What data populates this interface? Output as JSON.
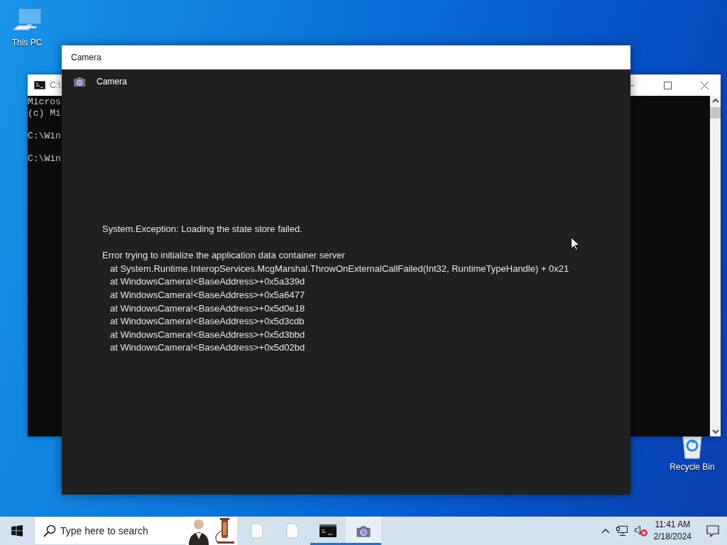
{
  "desktop_icons": [
    {
      "kind": "computer",
      "label": "This PC"
    },
    {
      "kind": "recycle",
      "label": "Recycle Bin"
    }
  ],
  "console_window": {
    "title": "C:\\",
    "blocks": [
      [
        "Micros",
        "(c) Mi"
      ],
      [
        "C:\\Win"
      ],
      [
        "C:\\Win"
      ]
    ]
  },
  "camera_window": {
    "title": "Camera",
    "app_title": "Camera",
    "error_heading": "System.Exception: Loading the state store failed.",
    "error_message": "Error trying to initialize the application data container server",
    "stack": [
      "at System.Runtime.InteropServices.McgMarshal.ThrowOnExternalCallFailed(Int32, RuntimeTypeHandle) + 0x21",
      "at WindowsCamera!<BaseAddress>+0x5a339d",
      "at WindowsCamera!<BaseAddress>+0x5a6477",
      "at WindowsCamera!<BaseAddress>+0x5d0e18",
      "at WindowsCamera!<BaseAddress>+0x5d3cdb",
      "at WindowsCamera!<BaseAddress>+0x5d3bbd",
      "at WindowsCamera!<BaseAddress>+0x5d02bd"
    ]
  },
  "taskbar": {
    "search": {
      "placeholder": "Type here to search"
    },
    "apps": [
      {
        "kind": "file",
        "running": false,
        "selected": false
      },
      {
        "kind": "file",
        "running": false,
        "selected": false
      },
      {
        "kind": "console",
        "running": true,
        "selected": false
      },
      {
        "kind": "camera",
        "running": true,
        "selected": true
      }
    ],
    "time": "11:41 AM",
    "date": "2/18/2024"
  }
}
